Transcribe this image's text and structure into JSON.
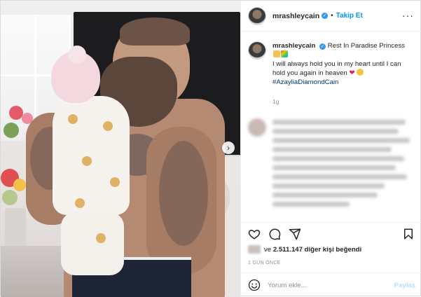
{
  "header": {
    "username": "mrashleycain",
    "verified_glyph": "✓",
    "separator": "•",
    "follow_label": "Takip Et",
    "more_label": "···"
  },
  "caption": {
    "username": "mrashleycain",
    "line1": "Rest In Paradise Princess",
    "line2": "I will always hold you in my heart until I can hold you again in heaven",
    "hashtag": "#AzayliaDiamondCain",
    "time": "1g"
  },
  "likes": {
    "prefix": "ve",
    "count": "2.511.147",
    "suffix": "diğer kişi beğendi"
  },
  "posted": "1 GÜN ÖNCE",
  "comment_box": {
    "placeholder": "Yorum ekle...",
    "share_label": "Paylaş"
  },
  "media": {
    "next_label": "›"
  },
  "colors": {
    "follow_blue": "#0095f6",
    "hashtag_blue": "#00376b",
    "heart_red": "#e0245e",
    "muted_gray": "#8e8e8e",
    "share_disabled": "#b2dffc"
  }
}
